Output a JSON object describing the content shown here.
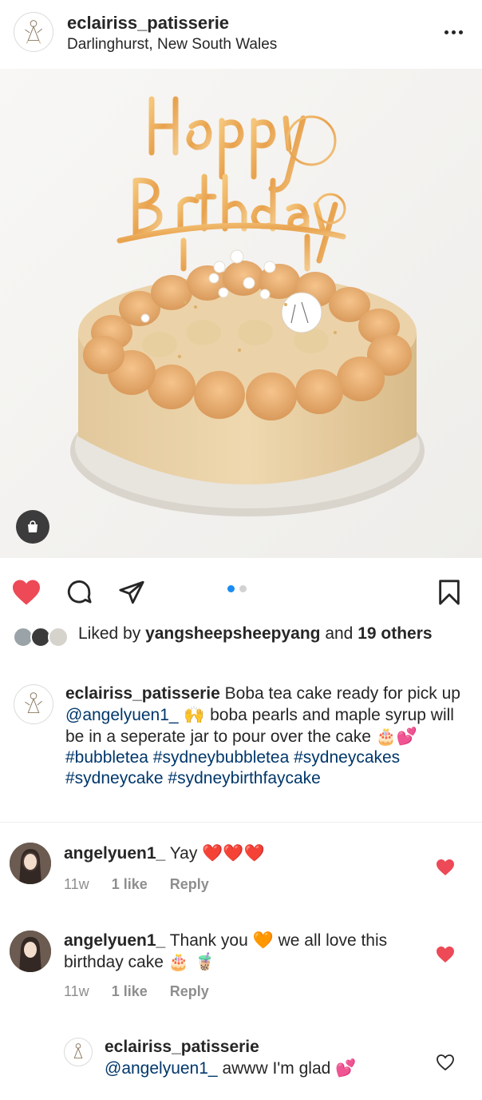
{
  "header": {
    "username": "eclairiss_patisserie",
    "location": "Darlinghurst, New South Wales",
    "more_icon": "more-horizontal-icon"
  },
  "post": {
    "image_description_icon": "cake-photo",
    "shop_icon": "shopping-bag-icon",
    "topper_text": "Happy Birthday",
    "pager": {
      "current": 1,
      "total": 2
    }
  },
  "actions": {
    "like_icon": "heart-filled-icon",
    "comment_icon": "comment-icon",
    "share_icon": "send-icon",
    "save_icon": "bookmark-icon"
  },
  "likes": {
    "prefix": "Liked by ",
    "user": "yangsheepsheepyang",
    "and": " and ",
    "count_text": "19 others"
  },
  "caption": {
    "username": "eclairiss_patisserie",
    "text1": " Boba tea cake ready for pick up ",
    "mention": "@angelyuen1_",
    "emoji1": " 🙌 ",
    "text2": "boba pearls and maple syrup will be in a seperate jar to pour over the cake ",
    "emoji2": "🎂💕 ",
    "hashtags": [
      "#bubbletea",
      "#sydneybubbletea",
      "#sydneycakes",
      "#sydneycake",
      "#sydneybirthfaycake"
    ]
  },
  "comments": [
    {
      "username": "angelyuen1_",
      "text": " Yay ",
      "hearts": "❤️❤️❤️",
      "time": "11w",
      "likes": "1 like",
      "reply": "Reply"
    },
    {
      "username": "angelyuen1_",
      "text": " Thank you ",
      "emoji_mid": "🧡",
      "text2": " we all love this birthday cake ",
      "emoji_end": "🎂 🧋",
      "time": "11w",
      "likes": "1 like",
      "reply": "Reply"
    }
  ],
  "reply": {
    "username": "eclairiss_patisserie",
    "mention": "@angelyuen1_",
    "text": " awww I'm glad ",
    "emoji": "💕"
  },
  "colors": {
    "like_red": "#ed4956",
    "link_blue": "#00376b",
    "pager_active": "#1a8cf0",
    "meta_gray": "#8e8e8e"
  }
}
